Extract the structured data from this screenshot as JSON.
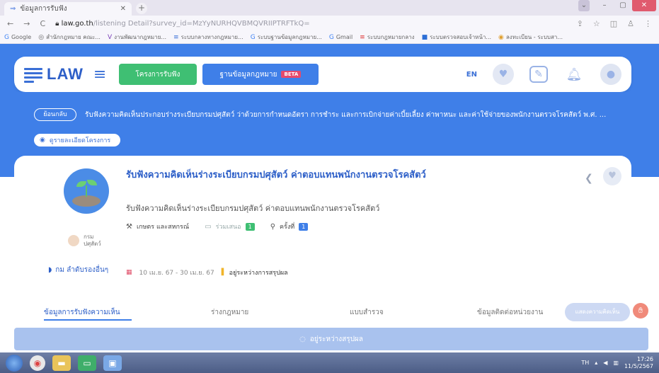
{
  "browser": {
    "tab_title": "ข้อมูลการรับฟัง",
    "url_host": "law.go.th",
    "url_path": "/listening Detail?survey_id=MzYyNURHQVBMQVRIIPTRFTkQ=",
    "bookmarks": [
      {
        "icon": "google-icon",
        "label": "Google"
      },
      {
        "icon": "link-icon",
        "label": "สำนักกฎหมาย คณะ..."
      },
      {
        "icon": "v-icon",
        "label": "งานพัฒนากฎหมาย..."
      },
      {
        "icon": "link-icon",
        "label": "ระบบกลางทางกฎหมาย..."
      },
      {
        "icon": "google-icon",
        "label": "ระบบฐานข้อมูลกฎหมาย..."
      },
      {
        "icon": "gmail-icon",
        "label": "Gmail"
      },
      {
        "icon": "link-icon",
        "label": "ระบบกฎหมายกลาง"
      },
      {
        "icon": "sheet-icon",
        "label": "ระบบตรวจสอบเจ้าหน้า..."
      },
      {
        "icon": "link-icon",
        "label": "ลงทะเบียน - ระบบสา..."
      }
    ]
  },
  "header": {
    "logo_text": "LAW",
    "nav_primary": "โครงการรับฟัง",
    "nav_secondary": "ฐานข้อมูลกฎหมาย",
    "beta_label": "BETA",
    "lang": "EN"
  },
  "banner": {
    "back_label": "ย้อนกลับ",
    "title": "รับฟังความคิดเห็นประกอบร่างระเบียบกรมปศุสัตว์ ว่าด้วยการกำหนดอัตรา การชำระ และการเบิกจ่ายค่าเบี้ยเลี้ยง ค่าพาหนะ และค่าใช้จ่ายของพนักงานตรวจโรคสัตว์ พ.ศ. ...",
    "view_label": "ดูรายละเอียดโครงการ"
  },
  "project": {
    "title": "รับฟังความคิดเห็นร่างระเบียบกรมปศุสัตว์ ค่าตอบแทนพนักงานตรวจโรคสัตว์",
    "subtitle": "รับฟังความคิดเห็นร่างระเบียบกรมปศุสัตว์ ค่าตอบแทนพนักงานตรวจโรคสัตว์",
    "category": "เกษตร และสหกรณ์",
    "opinions_label": "ร่วมเสนอ",
    "opinions_count": "1",
    "times_label": "ครั้งที่",
    "times_count": "1",
    "agency_line1": "กรม",
    "agency_line2": "ปศุสัตว์",
    "dept_link": "กม ลำดับรองอื่นๆ",
    "date_range": "10 เม.ย. 67 - 30 เม.ย. 67",
    "status": "อยู่ระหว่างการสรุปผล"
  },
  "tabs": [
    "ข้อมูลการรับฟังความเห็น",
    "ร่างกฎหมาย",
    "แบบสำรวจ",
    "ข้อมูลติดต่อหน่วยงาน"
  ],
  "comment_button": "แสดงความคิดเห็น",
  "status_bar": "อยู่ระหว่างสรุปผล",
  "taskbar": {
    "lang": "TH",
    "time": "17:26",
    "date": "11/5/2567"
  },
  "colors": {
    "brand_blue": "#3f7fe8",
    "green": "#3fbf73",
    "beta_pink": "#e64a6b"
  }
}
